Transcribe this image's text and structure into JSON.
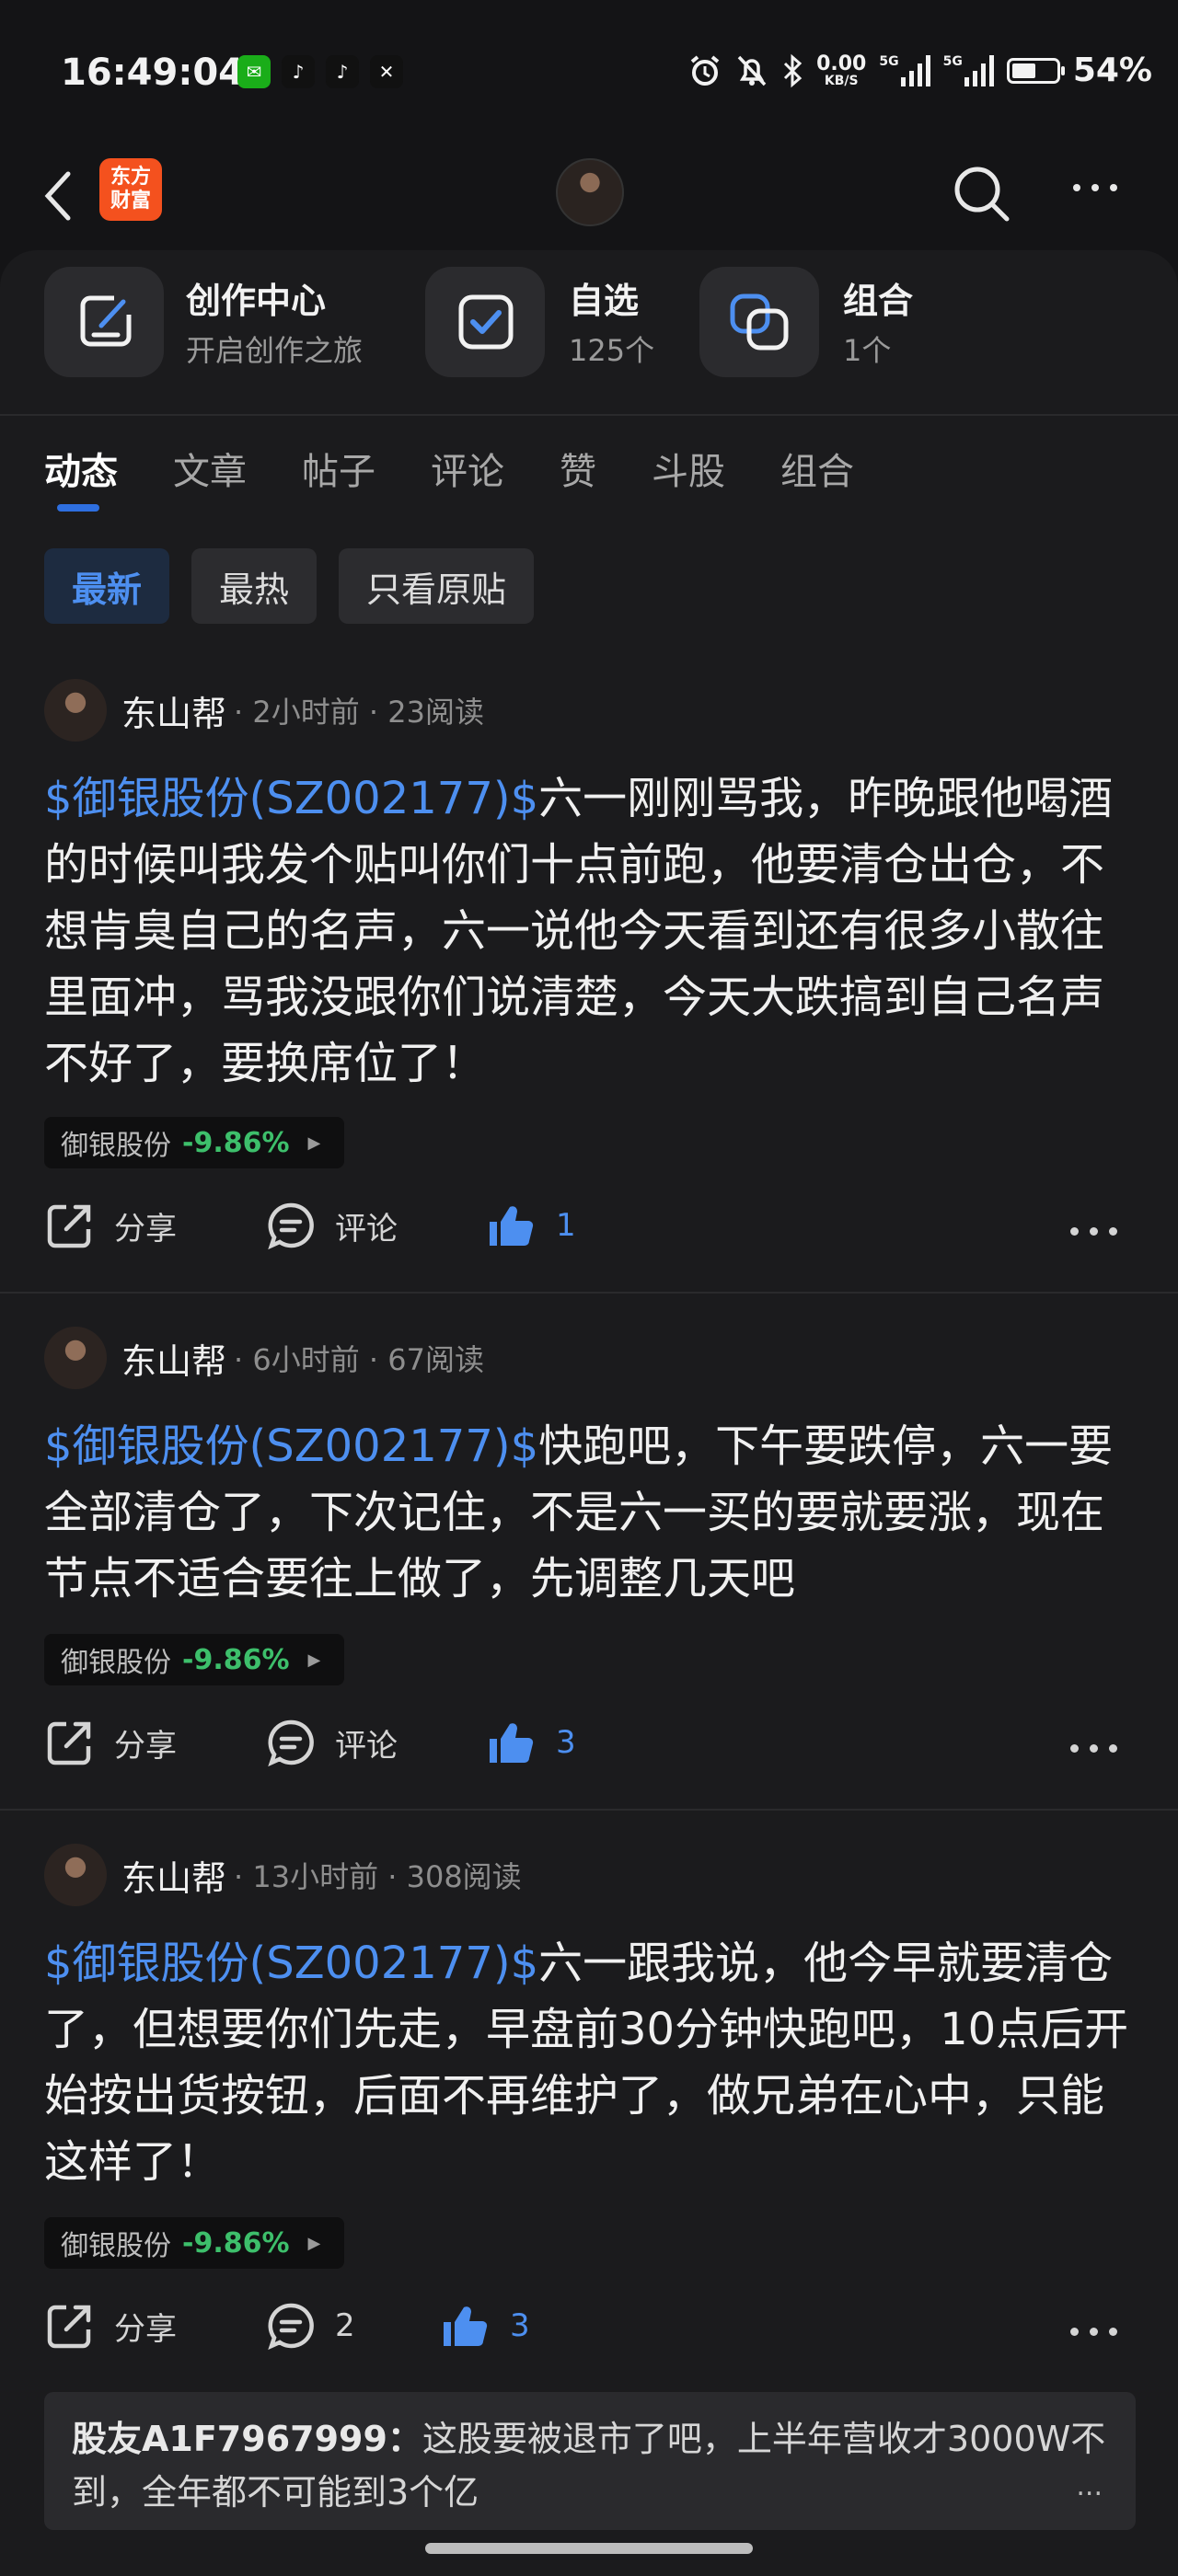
{
  "status_bar": {
    "time": "16:49:04",
    "net_speed_value": "0.00",
    "net_speed_unit": "KB/S",
    "signal_1": "5G",
    "signal_2": "5G",
    "battery_percent": "54%",
    "battery_level": 0.54
  },
  "nav": {
    "logo_text_line1": "东方",
    "logo_text_line2": "财富"
  },
  "quick_entries": [
    {
      "title": "创作中心",
      "subtitle": "开启创作之旅",
      "icon": "edit-icon"
    },
    {
      "title": "自选",
      "subtitle": "125个",
      "icon": "checkbox-icon"
    },
    {
      "title": "组合",
      "subtitle": "1个",
      "icon": "portfolio-icon"
    }
  ],
  "tabs": [
    "动态",
    "文章",
    "帖子",
    "评论",
    "赞",
    "斗股",
    "组合"
  ],
  "active_tab": "动态",
  "filters": [
    "最新",
    "最热",
    "只看原贴"
  ],
  "active_filter": "最新",
  "actions": {
    "share": "分享",
    "comment": "评论"
  },
  "posts": [
    {
      "author": "东山帮",
      "meta": "· 2小时前 · 23阅读",
      "stock_link": "$御银股份(SZ002177)$",
      "text": "六一刚刚骂我，昨晚跟他喝酒的时候叫我发个贴叫你们十点前跑，他要清仓出仓，不想肯臭自己的名声，六一说他今天看到还有很多小散往里面冲，骂我没跟你们说清楚，今天大跌搞到自己名声不好了，要换席位了！",
      "stock_name": "御银股份",
      "stock_change": "-9.86%",
      "likes": "1"
    },
    {
      "author": "东山帮",
      "meta": "· 6小时前 · 67阅读",
      "stock_link": "$御银股份(SZ002177)$",
      "text": "快跑吧，下午要跌停，六一要全部清仓了，下次记住，不是六一买的要就要涨，现在节点不适合要往上做了，先调整几天吧",
      "stock_name": "御银股份",
      "stock_change": "-9.86%",
      "likes": "3"
    },
    {
      "author": "东山帮",
      "meta": "· 13小时前 · 308阅读",
      "stock_link": "$御银股份(SZ002177)$",
      "text": "六一跟我说，他今早就要清仓了，但想要你们先走，早盘前30分钟快跑吧，10点后开始按出货按钮，后面不再维护了，做兄弟在心中，只能这样了！",
      "stock_name": "御银股份",
      "stock_change": "-9.86%",
      "comments": "2",
      "likes": "3"
    }
  ],
  "preview_comment": {
    "author": "股友A1F7967999：",
    "text": "这股要被退市了吧，上半年营收才3000W不到，全年都不可能到3个亿",
    "more": "..."
  },
  "colors": {
    "accent": "#4D8FF0",
    "down": "#3DBF6B",
    "logo": "#F4511E"
  }
}
